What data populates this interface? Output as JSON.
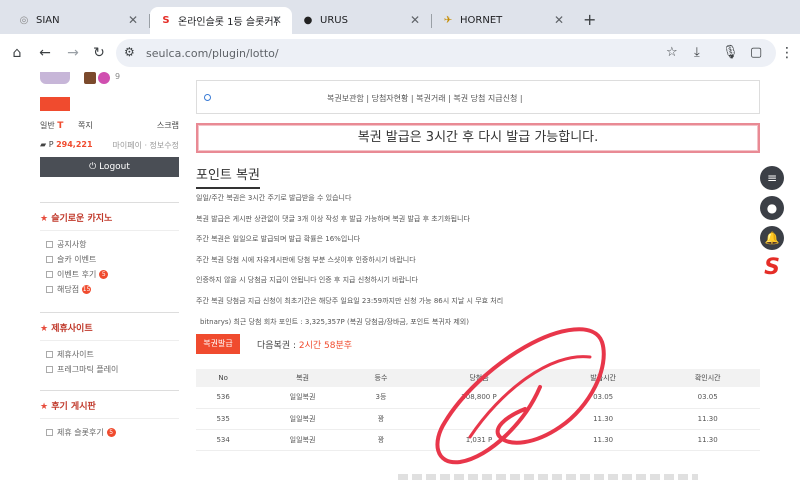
{
  "browser": {
    "tabs": [
      {
        "title": "SIAN",
        "favicon": "globe-icon",
        "active": false
      },
      {
        "title": "온라인슬롯 1등 슬롯커뮤니티 ·",
        "favicon": "s-logo-icon",
        "active": true
      },
      {
        "title": "URUS",
        "favicon": "dark-circle-icon",
        "active": false
      },
      {
        "title": "HORNET",
        "favicon": "hornet-icon",
        "active": false
      }
    ],
    "url": "seulca.com/plugin/lotto/"
  },
  "sidebar": {
    "avatar_count": "9",
    "level_label": "",
    "stats": {
      "level_prefix": "일반",
      "level_value": "T",
      "checkin": "쪽지",
      "scrap": "스크랩"
    },
    "points": {
      "label": "P",
      "value": "294,221",
      "links": "마이페이 · 정보수정"
    },
    "logout_label": "Logout",
    "sections": [
      {
        "title": "슬기로운 카지노",
        "items": [
          {
            "label": "공지사항",
            "badge": ""
          },
          {
            "label": "슬카 이벤트",
            "badge": ""
          },
          {
            "label": "이벤트 후기",
            "badge": "5"
          },
          {
            "label": "해당점",
            "badge": "15"
          }
        ]
      },
      {
        "title": "제휴사이트",
        "items": [
          {
            "label": "제휴사이트",
            "badge": ""
          },
          {
            "label": "프레그마틱 플레이",
            "badge": ""
          }
        ]
      },
      {
        "title": "후기 게시판",
        "items": [
          {
            "label": "제휴 슬롯후기",
            "badge": "5"
          }
        ]
      }
    ]
  },
  "main": {
    "top_links": "복권보관함 | 당첨자현황 | 복권거래 | 복권 당첨 지급신청 |",
    "notice": "복권 발급은 3시간 후 다시 발급 가능합니다.",
    "section_title": "포인트 복권",
    "rules": [
      "일일/주간 복권은 3시간 주기로 발급받을 수 있습니다",
      "복권 발급은 게시판 상관없이 댓글 3개 이상 작성 후 발급 가능하며 복권 발급 후 초기화됩니다",
      "주간 복권은 일일으로 발급되며 발급 확률은 16%입니다",
      "주간 복권 당첨 시에 자유게시판에 당첨 부분 스샷이후 인증하시기 바랍니다",
      "인증하지 않을 시 당첨금 지급이 안됩니다 인증 후 지급 신청하시기 바랍니다",
      "주간 복권 당첨금 지급 신청이 최초기간은 해당주 일요일 23:59까지만 신청 가능 86시 지날 시 무효 처리"
    ],
    "info_line": "bitnarys) 최근 당첨 회차 포인트 : 3,325,357P (복권 당첨금/장바금, 포인트 복귀자 제외)",
    "issue_button": "복권발급",
    "next_issue_label": "다음복권 :",
    "next_issue_value": "2시간 58분후",
    "table": {
      "headers": [
        "No",
        "복권",
        "등수",
        "당첨금",
        "발급시간",
        "확인시간"
      ],
      "rows": [
        [
          "536",
          "일일복권",
          "3등",
          "208,800 P",
          "03.05",
          "03.05"
        ],
        [
          "535",
          "일일복권",
          "꽝",
          "",
          "11.30",
          "11.30"
        ],
        [
          "534",
          "일일복권",
          "꽝",
          "1,031 P",
          "11.30",
          "11.30"
        ]
      ]
    }
  },
  "floating": [
    "menu-icon",
    "user-icon",
    "bell-icon",
    "s-logo-icon"
  ],
  "colors": {
    "accent": "#f04b2e",
    "notice_border": "#e98a94",
    "scribble": "#e8364a"
  }
}
